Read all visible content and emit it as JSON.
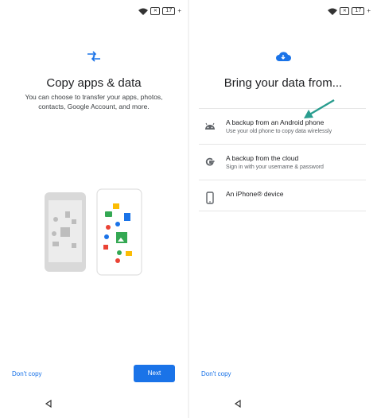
{
  "status_bar": {
    "battery": "17"
  },
  "copy_screen": {
    "title": "Copy apps & data",
    "subtitle": "You can choose to transfer your apps, photos, contacts, Google Account, and more.",
    "dont_copy_label": "Don't copy",
    "next_label": "Next",
    "hero_icon": "transfer-arrows-icon"
  },
  "source_screen": {
    "title": "Bring your data from...",
    "hero_icon": "cloud-download-icon",
    "options": [
      {
        "label": "A backup from an Android phone",
        "sublabel": "Use your old phone to copy data wirelessly",
        "icon": "android-icon"
      },
      {
        "label": "A backup from the cloud",
        "sublabel": "Sign in with your username & password",
        "icon": "google-icon"
      },
      {
        "label": "An iPhone® device",
        "sublabel": "",
        "icon": "iphone-icon"
      }
    ],
    "dont_copy_label": "Don't copy"
  },
  "colors": {
    "accent": "#1a73e8",
    "annotation_arrow": "#2a9d8f"
  }
}
